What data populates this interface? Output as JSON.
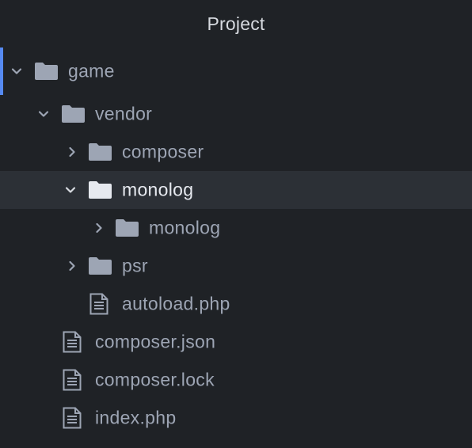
{
  "panel": {
    "title": "Project"
  },
  "colors": {
    "background": "#1f2226",
    "selected_row": "#2c3036",
    "focus_accent": "#568af2",
    "text": "#9da5b4",
    "text_selected": "#e6e9ef",
    "folder_icon": "#9da5b4",
    "folder_icon_open": "#d7dae0"
  },
  "tree": {
    "root": {
      "label": "game",
      "type": "folder",
      "state": "expanded",
      "icon": "folder-icon"
    },
    "vendor": {
      "label": "vendor",
      "type": "folder",
      "state": "expanded",
      "icon": "folder-icon"
    },
    "composer_dir": {
      "label": "composer",
      "type": "folder",
      "state": "collapsed",
      "icon": "folder-icon"
    },
    "monolog_dir": {
      "label": "monolog",
      "type": "folder",
      "state": "expanded",
      "selected": true,
      "icon": "folder-open-icon"
    },
    "monolog_sub": {
      "label": "monolog",
      "type": "folder",
      "state": "collapsed",
      "icon": "folder-icon"
    },
    "psr": {
      "label": "psr",
      "type": "folder",
      "state": "collapsed",
      "icon": "folder-icon"
    },
    "autoload": {
      "label": "autoload.php",
      "type": "file",
      "icon": "file-text-icon"
    },
    "composer_json": {
      "label": "composer.json",
      "type": "file",
      "icon": "file-text-icon"
    },
    "composer_lock": {
      "label": "composer.lock",
      "type": "file",
      "icon": "file-text-icon"
    },
    "index": {
      "label": "index.php",
      "type": "file",
      "icon": "file-text-icon"
    }
  }
}
